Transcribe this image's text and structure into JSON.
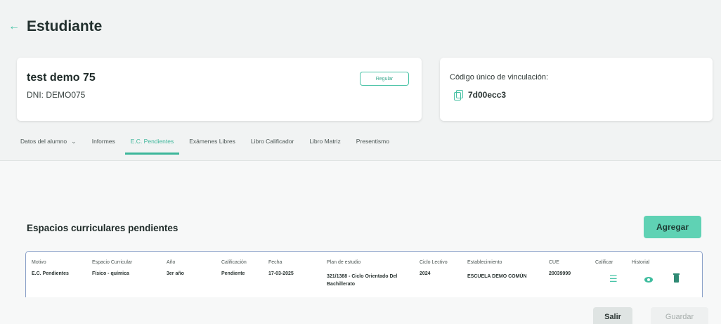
{
  "header": {
    "title": "Estudiante"
  },
  "student": {
    "name": "test demo 75",
    "dni": "DNI: DEMO075",
    "status_badge": "Regular"
  },
  "link_code": {
    "label": "Código único de vinculación:",
    "value": "7d00ecc3"
  },
  "tabs": [
    {
      "label": "Datos del alumno",
      "has_dropdown": true
    },
    {
      "label": "Informes"
    },
    {
      "label": "E.C. Pendientes",
      "active": true
    },
    {
      "label": "Exámenes Libres"
    },
    {
      "label": "Libro Calificador"
    },
    {
      "label": "Libro Matriz"
    },
    {
      "label": "Presentismo"
    }
  ],
  "section": {
    "title": "Espacios curriculares pendientes",
    "add_label": "Agregar"
  },
  "table": {
    "headers": [
      "Motivo",
      "Espacio Curricular",
      "Año",
      "Calificación",
      "Fecha",
      "Plan de estudio",
      "Ciclo Lectivo",
      "Establecimiento",
      "CUE",
      "Calificar",
      "Historial"
    ],
    "rows": [
      {
        "motivo": "E.C. Pendientes",
        "espacio": "Físico - química",
        "anio": "3er año",
        "calificacion": "Pendiente",
        "fecha": "17-03-2025",
        "plan": "321/1388 - Ciclo Orientado Del Bachillerato",
        "ciclo": "2024",
        "establecimiento": "ESCUELA DEMO COMÚN",
        "cue": "20039999"
      }
    ]
  },
  "footer": {
    "exit_label": "Salir",
    "save_label": "Guardar"
  },
  "colors": {
    "accent": "#48c4a7",
    "accent_button": "#5fd2b4"
  },
  "icons": [
    "back-arrow-icon",
    "copy-icon",
    "chevron-down-icon",
    "list-icon",
    "eye-icon",
    "trash-icon"
  ]
}
